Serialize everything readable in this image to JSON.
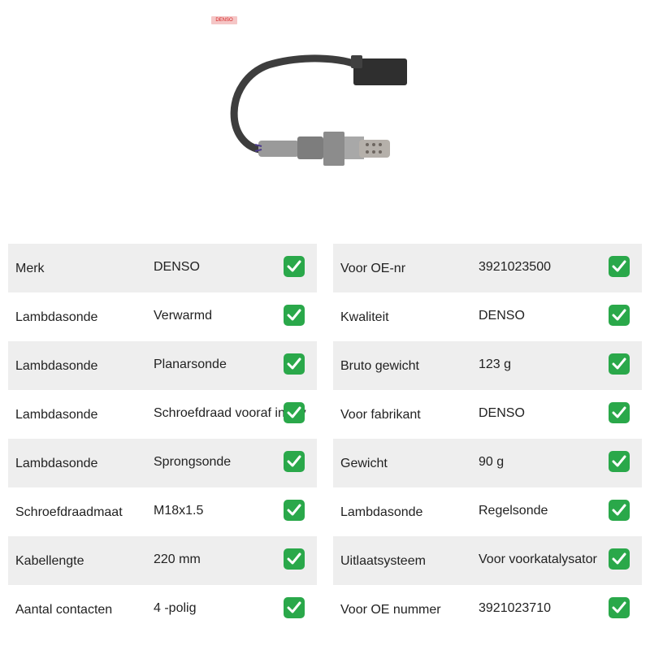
{
  "brand_logo_text": "DENSO",
  "spec_table_left": [
    {
      "label": "Merk",
      "value": "DENSO",
      "icon": "checkmark-icon"
    },
    {
      "label": "Lambdasonde",
      "value": "Verwarmd",
      "icon": "checkmark-icon"
    },
    {
      "label": "Lambdasonde",
      "value": "Planarsonde",
      "icon": "checkmark-icon"
    },
    {
      "label": "Lambdasonde",
      "value": "Schroefdraad vooraf ingev",
      "icon": "checkmark-icon"
    },
    {
      "label": "Lambdasonde",
      "value": "Sprongsonde",
      "icon": "checkmark-icon"
    },
    {
      "label": "Schroefdraadmaat",
      "value": "M18x1.5",
      "icon": "checkmark-icon"
    },
    {
      "label": "Kabellengte",
      "value": "220 mm",
      "icon": "checkmark-icon"
    },
    {
      "label": "Aantal contacten",
      "value": "4 -polig",
      "icon": "checkmark-icon"
    }
  ],
  "spec_table_right": [
    {
      "label": "Voor OE-nr",
      "value": "3921023500",
      "icon": "checkmark-icon"
    },
    {
      "label": "Kwaliteit",
      "value": "DENSO",
      "icon": "checkmark-icon"
    },
    {
      "label": "Bruto gewicht",
      "value": "123 g",
      "icon": "checkmark-icon"
    },
    {
      "label": "Voor fabrikant",
      "value": "DENSO",
      "icon": "checkmark-icon"
    },
    {
      "label": "Gewicht",
      "value": "90 g",
      "icon": "checkmark-icon"
    },
    {
      "label": "Lambdasonde",
      "value": "Regelsonde",
      "icon": "checkmark-icon"
    },
    {
      "label": "Uitlaatsysteem",
      "value": "Voor voorkatalysator",
      "icon": "checkmark-icon"
    },
    {
      "label": "Voor OE nummer",
      "value": "3921023710",
      "icon": "checkmark-icon"
    }
  ],
  "colors": {
    "row_shade": "#eeeeee",
    "check_green": "#2aa84a",
    "logo_red": "#d42020"
  }
}
